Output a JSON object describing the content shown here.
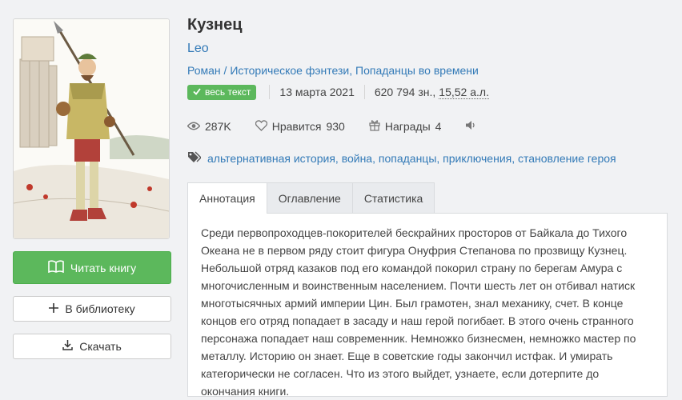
{
  "book": {
    "title": "Кузнец",
    "author": "Leo",
    "genre_prefix": "Роман / ",
    "genres": [
      "Историческое фэнтези",
      "Попаданцы во времени"
    ],
    "genre_separator": ", ",
    "full_text_badge": "весь текст",
    "date": "13 марта 2021",
    "size_chars": "620 794 зн., ",
    "size_sheets": "15,52 а.л."
  },
  "stats": {
    "views": "287K",
    "likes_label": "Нравится",
    "likes_count": "930",
    "awards_label": "Награды",
    "awards_count": "4"
  },
  "tags": [
    "альтернативная история",
    "война",
    "попаданцы",
    "приключения",
    "становление героя"
  ],
  "tag_separator": ", ",
  "buttons": {
    "read": "Читать книгу",
    "library": "В библиотеку",
    "download": "Скачать"
  },
  "tabs": [
    {
      "label": "Аннотация",
      "active": true
    },
    {
      "label": "Оглавление",
      "active": false
    },
    {
      "label": "Статистика",
      "active": false
    }
  ],
  "annotation": "Среди первопроходцев-покорителей бескрайних просторов от Байкала до Тихого Океана не в первом ряду стоит фигура Онуфрия Степанова по прозвищу Кузнец. Небольшой отряд казаков под его командой покорил страну по берегам Амура с многочисленным и воинственным населением. Почти шесть лет он отбивал натиск многотысячных армий империи Цин. Был грамотен, знал механику, счет. В конце концов его отряд попадает в засаду и наш герой погибает. В этого очень странного персонажа попадает наш современник. Немножко бизнесмен, немножко мастер по металлу. Историю он знает. Еще в советские годы закончил истфак. И умирать категорически не согласен. Что из этого выйдет, узнаете, если дотерпите до окончания книги.",
  "colors": {
    "accent": "#337ab7",
    "success": "#5cb85c",
    "background": "#f1f2f4"
  },
  "icons": [
    "book-open-icon",
    "plus-icon",
    "download-icon",
    "eye-icon",
    "heart-icon",
    "gift-icon",
    "speaker-icon",
    "tag-icon",
    "check-icon"
  ]
}
